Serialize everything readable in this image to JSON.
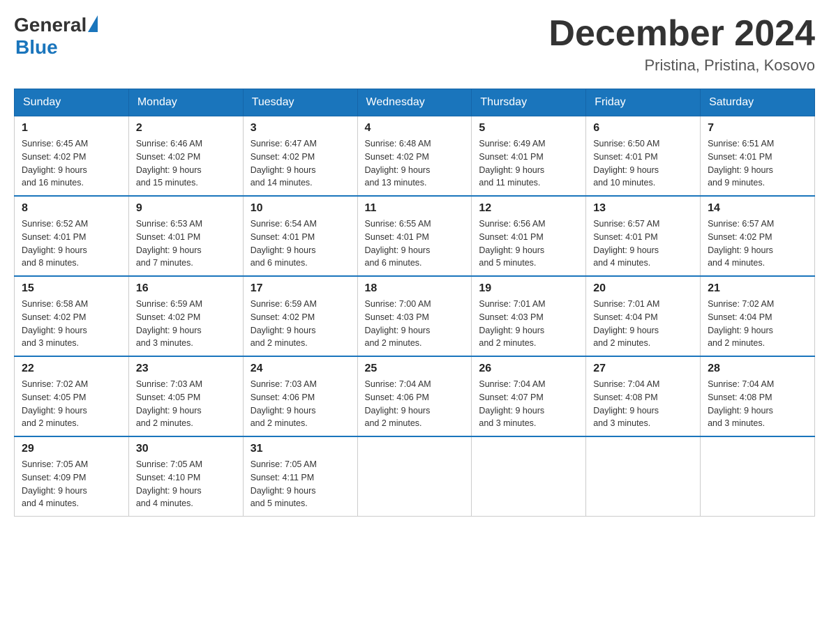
{
  "header": {
    "logo_general": "General",
    "logo_blue": "Blue",
    "month_title": "December 2024",
    "location": "Pristina, Pristina, Kosovo"
  },
  "days_of_week": [
    "Sunday",
    "Monday",
    "Tuesday",
    "Wednesday",
    "Thursday",
    "Friday",
    "Saturday"
  ],
  "weeks": [
    [
      {
        "day": 1,
        "sunrise": "6:45 AM",
        "sunset": "4:02 PM",
        "daylight": "9 hours and 16 minutes."
      },
      {
        "day": 2,
        "sunrise": "6:46 AM",
        "sunset": "4:02 PM",
        "daylight": "9 hours and 15 minutes."
      },
      {
        "day": 3,
        "sunrise": "6:47 AM",
        "sunset": "4:02 PM",
        "daylight": "9 hours and 14 minutes."
      },
      {
        "day": 4,
        "sunrise": "6:48 AM",
        "sunset": "4:02 PM",
        "daylight": "9 hours and 13 minutes."
      },
      {
        "day": 5,
        "sunrise": "6:49 AM",
        "sunset": "4:01 PM",
        "daylight": "9 hours and 11 minutes."
      },
      {
        "day": 6,
        "sunrise": "6:50 AM",
        "sunset": "4:01 PM",
        "daylight": "9 hours and 10 minutes."
      },
      {
        "day": 7,
        "sunrise": "6:51 AM",
        "sunset": "4:01 PM",
        "daylight": "9 hours and 9 minutes."
      }
    ],
    [
      {
        "day": 8,
        "sunrise": "6:52 AM",
        "sunset": "4:01 PM",
        "daylight": "9 hours and 8 minutes."
      },
      {
        "day": 9,
        "sunrise": "6:53 AM",
        "sunset": "4:01 PM",
        "daylight": "9 hours and 7 minutes."
      },
      {
        "day": 10,
        "sunrise": "6:54 AM",
        "sunset": "4:01 PM",
        "daylight": "9 hours and 6 minutes."
      },
      {
        "day": 11,
        "sunrise": "6:55 AM",
        "sunset": "4:01 PM",
        "daylight": "9 hours and 6 minutes."
      },
      {
        "day": 12,
        "sunrise": "6:56 AM",
        "sunset": "4:01 PM",
        "daylight": "9 hours and 5 minutes."
      },
      {
        "day": 13,
        "sunrise": "6:57 AM",
        "sunset": "4:01 PM",
        "daylight": "9 hours and 4 minutes."
      },
      {
        "day": 14,
        "sunrise": "6:57 AM",
        "sunset": "4:02 PM",
        "daylight": "9 hours and 4 minutes."
      }
    ],
    [
      {
        "day": 15,
        "sunrise": "6:58 AM",
        "sunset": "4:02 PM",
        "daylight": "9 hours and 3 minutes."
      },
      {
        "day": 16,
        "sunrise": "6:59 AM",
        "sunset": "4:02 PM",
        "daylight": "9 hours and 3 minutes."
      },
      {
        "day": 17,
        "sunrise": "6:59 AM",
        "sunset": "4:02 PM",
        "daylight": "9 hours and 2 minutes."
      },
      {
        "day": 18,
        "sunrise": "7:00 AM",
        "sunset": "4:03 PM",
        "daylight": "9 hours and 2 minutes."
      },
      {
        "day": 19,
        "sunrise": "7:01 AM",
        "sunset": "4:03 PM",
        "daylight": "9 hours and 2 minutes."
      },
      {
        "day": 20,
        "sunrise": "7:01 AM",
        "sunset": "4:04 PM",
        "daylight": "9 hours and 2 minutes."
      },
      {
        "day": 21,
        "sunrise": "7:02 AM",
        "sunset": "4:04 PM",
        "daylight": "9 hours and 2 minutes."
      }
    ],
    [
      {
        "day": 22,
        "sunrise": "7:02 AM",
        "sunset": "4:05 PM",
        "daylight": "9 hours and 2 minutes."
      },
      {
        "day": 23,
        "sunrise": "7:03 AM",
        "sunset": "4:05 PM",
        "daylight": "9 hours and 2 minutes."
      },
      {
        "day": 24,
        "sunrise": "7:03 AM",
        "sunset": "4:06 PM",
        "daylight": "9 hours and 2 minutes."
      },
      {
        "day": 25,
        "sunrise": "7:04 AM",
        "sunset": "4:06 PM",
        "daylight": "9 hours and 2 minutes."
      },
      {
        "day": 26,
        "sunrise": "7:04 AM",
        "sunset": "4:07 PM",
        "daylight": "9 hours and 3 minutes."
      },
      {
        "day": 27,
        "sunrise": "7:04 AM",
        "sunset": "4:08 PM",
        "daylight": "9 hours and 3 minutes."
      },
      {
        "day": 28,
        "sunrise": "7:04 AM",
        "sunset": "4:08 PM",
        "daylight": "9 hours and 3 minutes."
      }
    ],
    [
      {
        "day": 29,
        "sunrise": "7:05 AM",
        "sunset": "4:09 PM",
        "daylight": "9 hours and 4 minutes."
      },
      {
        "day": 30,
        "sunrise": "7:05 AM",
        "sunset": "4:10 PM",
        "daylight": "9 hours and 4 minutes."
      },
      {
        "day": 31,
        "sunrise": "7:05 AM",
        "sunset": "4:11 PM",
        "daylight": "9 hours and 5 minutes."
      },
      null,
      null,
      null,
      null
    ]
  ]
}
